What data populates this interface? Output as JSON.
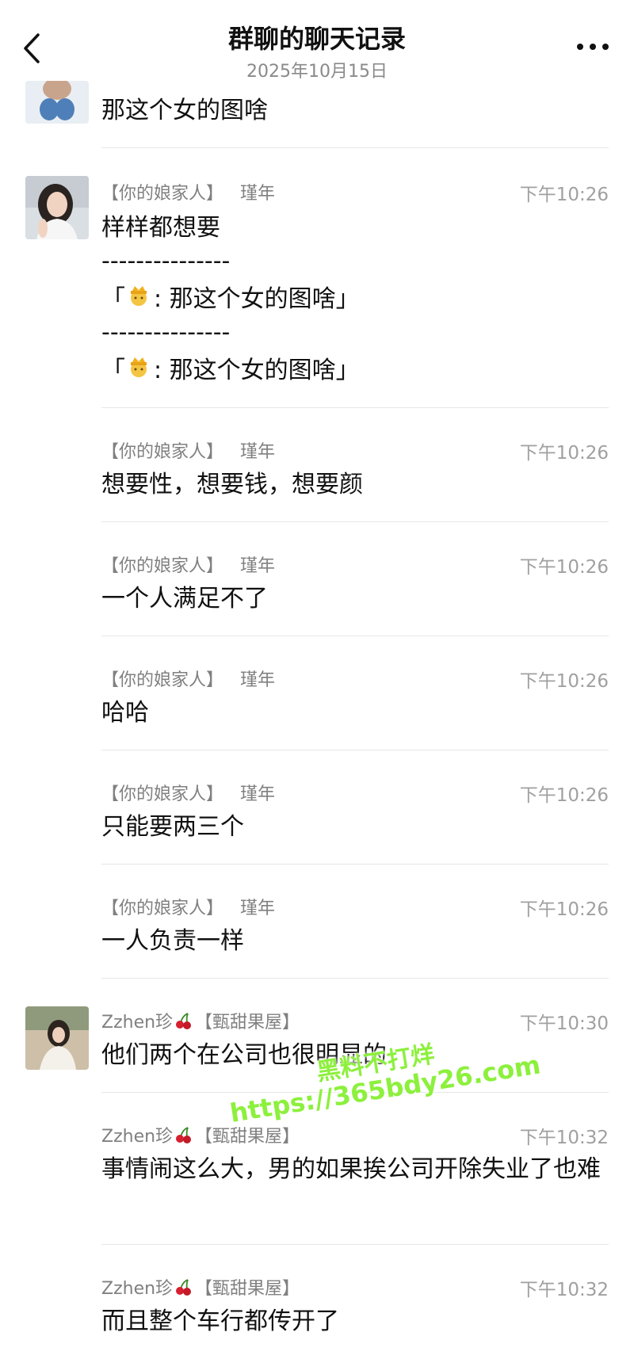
{
  "header": {
    "title": "群聊的聊天记录",
    "date": "2025年10月15日"
  },
  "messages": [
    {
      "text": "那这个女的图啥"
    },
    {
      "sender_group": "【你的娘家人】",
      "sender_name": "瑾年",
      "time": "下午10:26",
      "text": "样样都想要",
      "separator1": "---------------",
      "quote1": "那这个女的图啥",
      "separator2": "---------------",
      "quote2": "那这个女的图啥"
    },
    {
      "sender_group": "【你的娘家人】",
      "sender_name": "瑾年",
      "time": "下午10:26",
      "text": "想要性，想要钱，想要颜"
    },
    {
      "sender_group": "【你的娘家人】",
      "sender_name": "瑾年",
      "time": "下午10:26",
      "text": "一个人满足不了"
    },
    {
      "sender_group": "【你的娘家人】",
      "sender_name": "瑾年",
      "time": "下午10:26",
      "text": "哈哈"
    },
    {
      "sender_group": "【你的娘家人】",
      "sender_name": "瑾年",
      "time": "下午10:26",
      "text": "只能要两三个"
    },
    {
      "sender_group": "【你的娘家人】",
      "sender_name": "瑾年",
      "time": "下午10:26",
      "text": "一人负责一样"
    },
    {
      "sender_name": "Zzhen珍",
      "sender_group": "【甄甜果屋】",
      "time": "下午10:30",
      "text": "他们两个在公司也很明显的"
    },
    {
      "sender_name": "Zzhen珍",
      "sender_group": "【甄甜果屋】",
      "time": "下午10:32",
      "text": "事情闹这么大，男的如果挨公司开除失业了也难"
    },
    {
      "sender_name": "Zzhen珍",
      "sender_group": "【甄甜果屋】",
      "time": "下午10:32",
      "text": "而且整个车行都传开了"
    }
  ],
  "quote_open": "「",
  "quote_close": "」",
  "watermark": {
    "line1": "黑料不打烊",
    "line2": "https://365bdy26.com"
  },
  "colors": {
    "watermark": "#8cf03c",
    "meta_gray": "#808080",
    "divider": "#e6e6e6"
  },
  "icons": [
    "back-arrow-icon",
    "more-dots-icon",
    "cherry-emoji-icon",
    "princess-emoji-icon"
  ]
}
